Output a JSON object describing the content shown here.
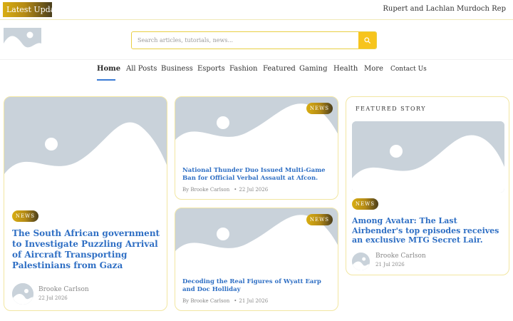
{
  "topbar": {
    "latest_label": "Latest Update",
    "ticker_text": "Rupert and Lachlan Murdoch Rep"
  },
  "header": {
    "search": {
      "placeholder": "Search articles, tutorials, news..."
    }
  },
  "nav": {
    "items": [
      {
        "label": "Home",
        "active": true
      },
      {
        "label": "All Posts"
      },
      {
        "label": "Business"
      },
      {
        "label": "Esports"
      },
      {
        "label": "Fashion"
      },
      {
        "label": "Featured"
      },
      {
        "label": "Gaming"
      },
      {
        "label": "Health"
      },
      {
        "label": "More"
      },
      {
        "label": "Contact Us"
      }
    ]
  },
  "main_story": {
    "badge": "NEWS",
    "title": "The South African government to Investigate Puzzling Arrival of Aircraft Transporting Palestinians from Gaza",
    "author": "Brooke Carlson",
    "date": "22 Jul 2026"
  },
  "middle_stories": [
    {
      "badge": "NEWS",
      "title": "National Thunder Duo Issued Multi-Game Ban for Official Verbal Assault at Afcon.",
      "author": "By Brooke Carlson",
      "date": "22 Jul 2026"
    },
    {
      "badge": "NEWS",
      "title": "Decoding the Real Figures of Wyatt Earp and Doc Holliday",
      "author": "By Brooke Carlson",
      "date": "21 Jul 2026"
    }
  ],
  "featured": {
    "label": "FEATURED STORY",
    "badge": "NEWS",
    "title": "Among Avatar: The Last Airbender's top episodes receives an exclusive MTG Secret Lair.",
    "author": "Brooke Carlson",
    "date": "21 Jul 2026"
  },
  "colors": {
    "accent_gold": "#f7c41c",
    "link_blue": "#2f6fc4",
    "placeholder_gray": "#c9d2da"
  }
}
